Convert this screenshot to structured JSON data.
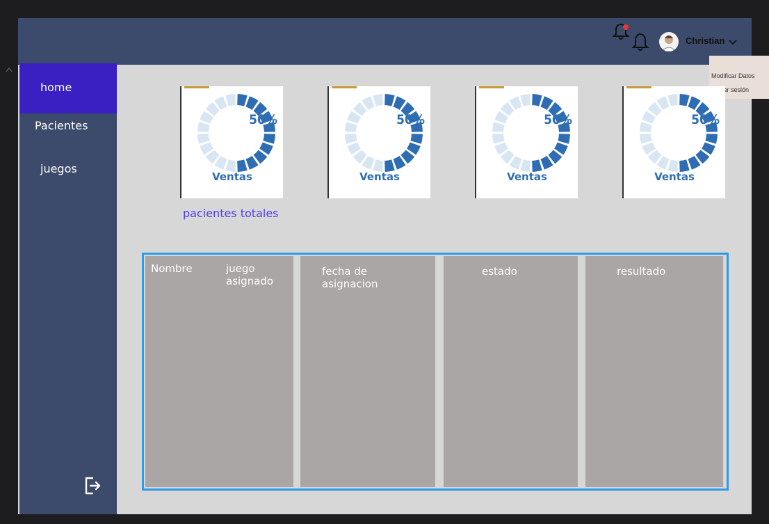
{
  "header": {
    "user_name": "Christian"
  },
  "user_menu": {
    "items": [
      "Modificar Datos",
      "Cerrar sesión"
    ]
  },
  "sidebar": {
    "items": [
      {
        "label": "home",
        "active": true
      },
      {
        "label": "Pacientes"
      },
      {
        "label": "juegos"
      }
    ]
  },
  "cards": [
    {
      "percent": "50%",
      "label": "Ventas",
      "value": 0.5
    },
    {
      "percent": "50%",
      "label": "Ventas",
      "value": 0.5
    },
    {
      "percent": "50%",
      "label": "Ventas",
      "value": 0.5
    },
    {
      "percent": "50%",
      "label": "Ventas",
      "value": 0.5
    }
  ],
  "cards_caption": "pacientes totales",
  "table": {
    "headers": [
      "Nombre",
      "juego asignado",
      "fecha de asignacion",
      "estado",
      "resultado"
    ]
  },
  "colors": {
    "topbar": "#3c4a6b",
    "sidebar": "#3c4a6b",
    "active": "#3a1fc2",
    "donut": "#2e6db3",
    "donut_light": "#d8e6f4",
    "table_border": "#2d9ce8",
    "caption": "#4d3cf0",
    "notification_dot": "#e53935"
  },
  "icons": [
    "bell-with-dot-icon",
    "bell-icon",
    "avatar",
    "chevron-down-icon",
    "logout-icon"
  ]
}
